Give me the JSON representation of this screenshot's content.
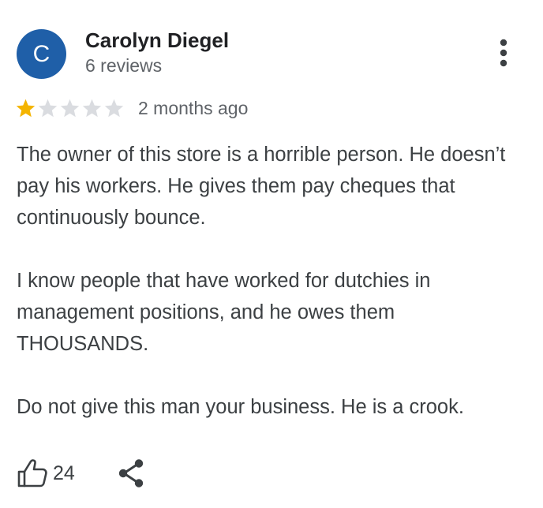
{
  "reviewer": {
    "initial": "C",
    "name": "Carolyn Diegel",
    "reviews": "6 reviews",
    "avatar_color": "#1f5fa8"
  },
  "rating": {
    "value": 1,
    "max": 5,
    "filled_color": "#f4b400",
    "empty_color": "#dadce0"
  },
  "date": "2 months ago",
  "review": {
    "paragraph_1": "The owner of this store is a horrible person. He doesn’t pay his workers. He gives them pay cheques that continuously bounce.",
    "paragraph_2": "I know people that have worked for dutchies in management positions, and he owes them THOUSANDS.",
    "paragraph_3": "Do not give this man your business. He is a crook."
  },
  "actions": {
    "like_count": "24",
    "like_icon": "thumbs-up-icon",
    "share_icon": "share-icon",
    "more_icon": "more-vert-icon"
  }
}
